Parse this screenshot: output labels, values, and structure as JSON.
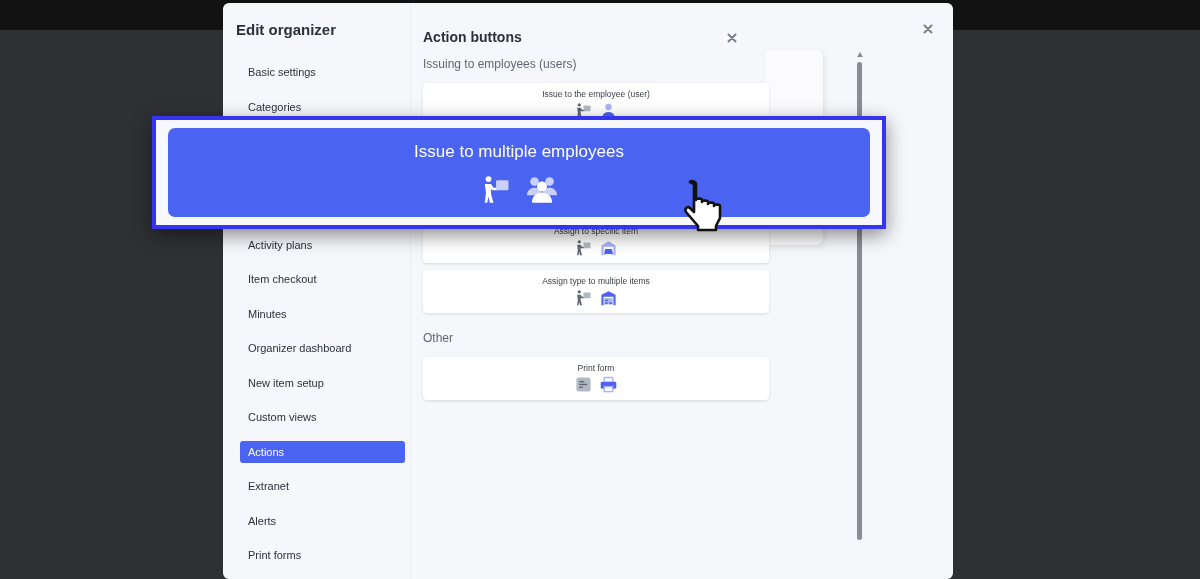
{
  "dialog": {
    "title": "Edit organizer"
  },
  "sidebar": {
    "items": [
      {
        "label": "Basic settings",
        "selected": false
      },
      {
        "label": "Categories",
        "selected": false
      },
      {
        "label": "Activity plans",
        "selected": false
      },
      {
        "label": "Item checkout",
        "selected": false
      },
      {
        "label": "Minutes",
        "selected": false
      },
      {
        "label": "Organizer dashboard",
        "selected": false
      },
      {
        "label": "New item setup",
        "selected": false
      },
      {
        "label": "Custom views",
        "selected": false
      },
      {
        "label": "Actions",
        "selected": true
      },
      {
        "label": "Extranet",
        "selected": false
      },
      {
        "label": "Alerts",
        "selected": false
      },
      {
        "label": "Print forms",
        "selected": false
      }
    ]
  },
  "panel": {
    "title": "Action buttons",
    "sections": [
      {
        "heading": "Issuing to employees (users)",
        "buttons": [
          {
            "label": "Issue to the employee (user)",
            "kind": "employee"
          },
          {
            "label": "Assign to specific item",
            "kind": "specific-item"
          },
          {
            "label": "Assign type to multiple items",
            "kind": "multiple-items"
          }
        ]
      },
      {
        "heading": "Other",
        "buttons": [
          {
            "label": "Print form",
            "kind": "print-form"
          }
        ]
      }
    ]
  },
  "callout": {
    "label": "Issue to multiple employees",
    "kind": "multiple-employees"
  }
}
